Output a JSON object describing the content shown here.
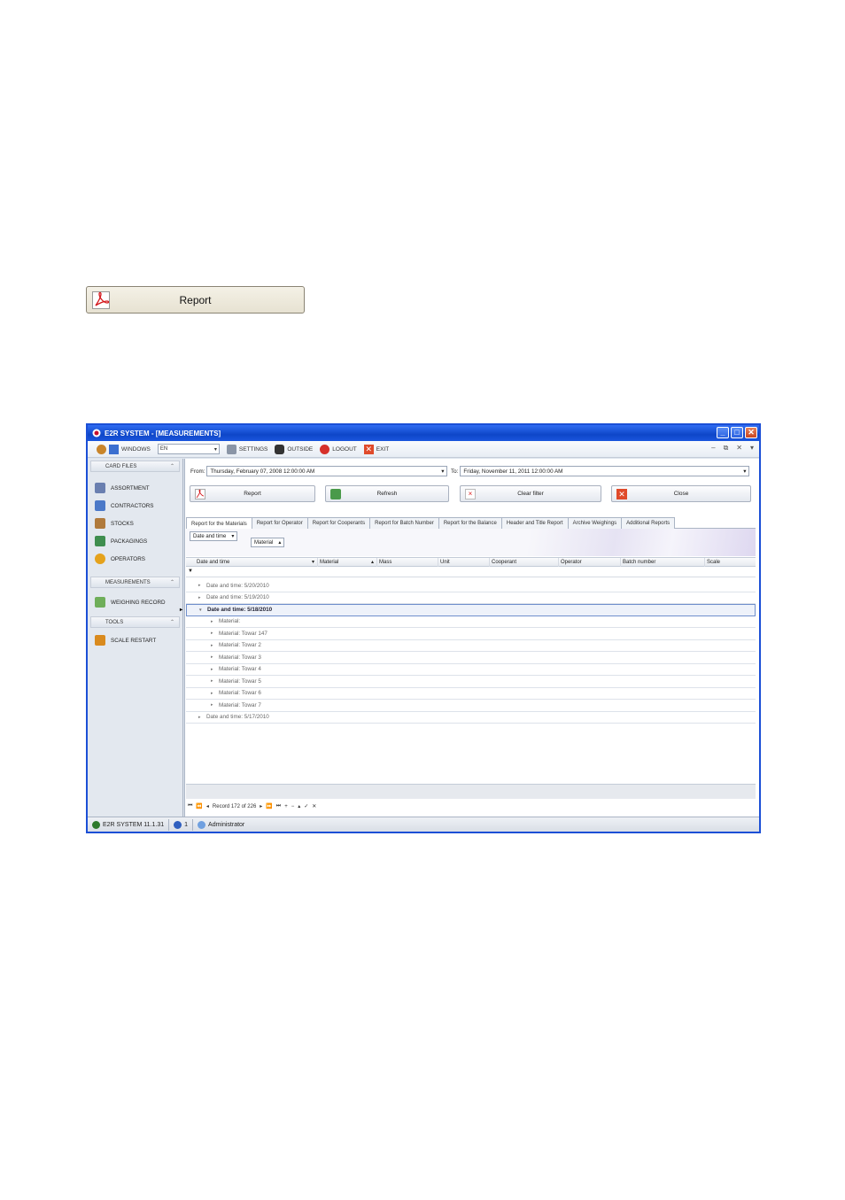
{
  "report_button": {
    "label": "Report"
  },
  "window": {
    "title": "E2R SYSTEM - [MEASUREMENTS]",
    "toolbar": {
      "windows_label": "WINDOWS",
      "language": "EN",
      "settings_label": "SETTINGS",
      "outside_label": "OUTSIDE",
      "logout_label": "LOGOUT",
      "exit_label": "EXIT"
    },
    "nav": {
      "card_files": {
        "header": "CARD FILES",
        "items": [
          "ASSORTMENT",
          "CONTRACTORS",
          "STOCKS",
          "PACKAGINGS",
          "OPERATORS"
        ]
      },
      "measurements": {
        "header": "MEASUREMENTS",
        "items": [
          "WEIGHING RECORD"
        ]
      },
      "tools": {
        "header": "TOOLS",
        "items": [
          "SCALE RESTART"
        ]
      }
    },
    "filter": {
      "from_label": "From:",
      "from_value": "Thursday, February 07, 2008 12:00:00 AM",
      "to_label": "To:",
      "to_value": "Friday, November 11, 2011 12:00:00 AM"
    },
    "actions": {
      "report": "Report",
      "refresh": "Refresh",
      "clear_filter": "Clear filter",
      "close": "Close"
    },
    "tabs": [
      "Report for the Materials",
      "Report for Operator",
      "Report for Cooperants",
      "Report for Batch Number",
      "Report for the Balance",
      "Header and Title Report",
      "Archive Weighings",
      "Additional Reports"
    ],
    "group_chips": [
      "Date and time",
      "Material"
    ],
    "columns": [
      "Date and time",
      "Material",
      "Mass",
      "Unit",
      "Cooperant",
      "Operator",
      "Batch number",
      "Scale"
    ],
    "rows": [
      {
        "text": "Date and time: 5/20/2010",
        "level": 0
      },
      {
        "text": "Date and time: 5/19/2010",
        "level": 0
      },
      {
        "text": "Date and time: 5/18/2010",
        "level": 0
      },
      {
        "text": "Material:",
        "level": 1
      },
      {
        "text": "Material: Towar 147",
        "level": 1
      },
      {
        "text": "Material: Towar 2",
        "level": 1
      },
      {
        "text": "Material: Towar 3",
        "level": 1
      },
      {
        "text": "Material: Towar 4",
        "level": 1
      },
      {
        "text": "Material: Towar 5",
        "level": 1
      },
      {
        "text": "Material: Towar 6",
        "level": 1
      },
      {
        "text": "Material: Towar 7",
        "level": 1
      },
      {
        "text": "Date and time: 5/17/2010",
        "level": 0
      }
    ],
    "record_nav": "Record 172 of 226",
    "status": {
      "version": "E2R SYSTEM 11.1.31",
      "users": "1",
      "user": "Administrator"
    }
  }
}
